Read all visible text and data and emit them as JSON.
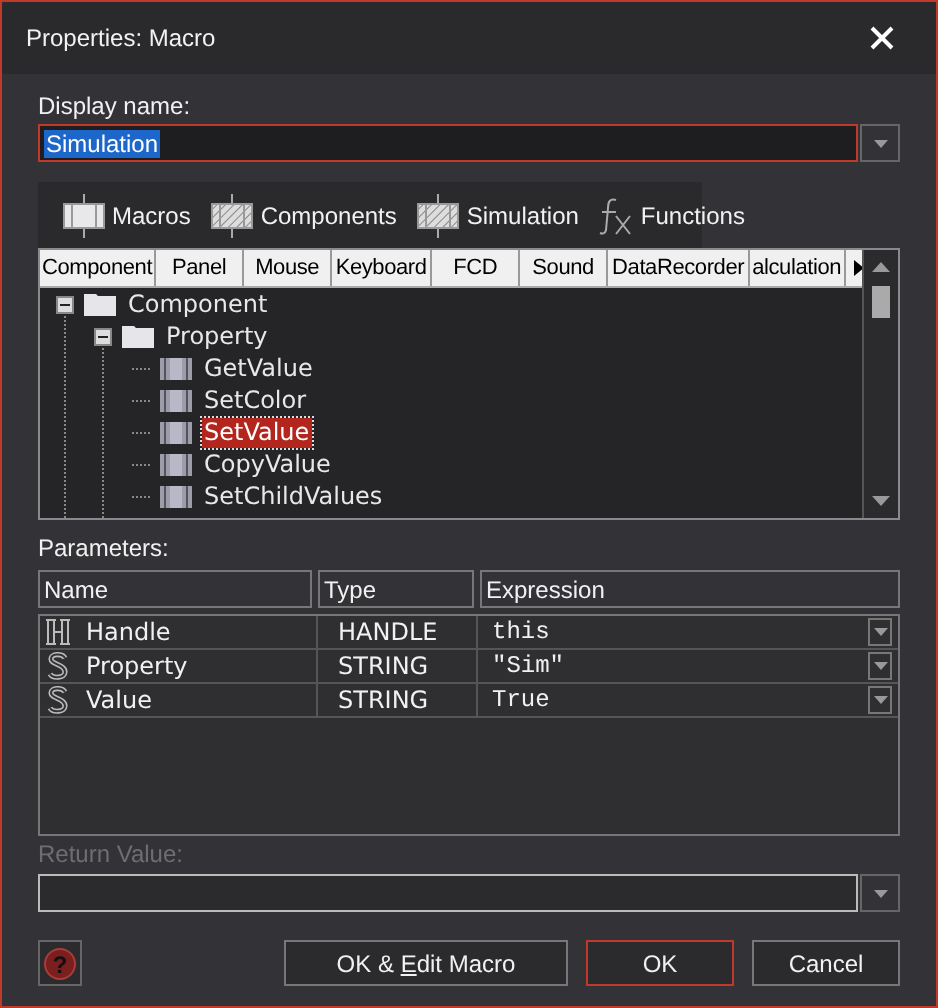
{
  "window": {
    "title": "Properties: Macro"
  },
  "display_name": {
    "label": "Display name:",
    "value": "Simulation",
    "value_selected": true,
    "focused": true
  },
  "tabs": [
    {
      "label": "Macros",
      "kind": "macros"
    },
    {
      "label": "Components",
      "kind": "components"
    },
    {
      "label": "Simulation",
      "kind": "simulation"
    },
    {
      "label": "Functions",
      "kind": "functions"
    }
  ],
  "tree": {
    "columns": [
      "Component",
      "Panel",
      "Mouse",
      "Keyboard",
      "FCD",
      "Sound",
      "DataRecorder",
      "alculation"
    ],
    "items": [
      {
        "label": "Component",
        "kind": "folder",
        "expanded": true,
        "selected": false,
        "children": [
          {
            "label": "Property",
            "kind": "folder",
            "expanded": true,
            "selected": false,
            "children": [
              {
                "label": "GetValue",
                "kind": "macro",
                "selected": false
              },
              {
                "label": "SetColor",
                "kind": "macro",
                "selected": false
              },
              {
                "label": "SetValue",
                "kind": "macro",
                "selected": true
              },
              {
                "label": "CopyValue",
                "kind": "macro",
                "selected": false
              },
              {
                "label": "SetChildValues",
                "kind": "macro",
                "selected": false
              }
            ]
          }
        ]
      }
    ]
  },
  "parameters": {
    "label": "Parameters:",
    "columns": [
      "Name",
      "Type",
      "Expression"
    ],
    "rows": [
      {
        "kind": "handle",
        "name": "Handle",
        "type": "HANDLE",
        "expression": "this"
      },
      {
        "kind": "string",
        "name": "Property",
        "type": "STRING",
        "expression": "\"Sim\""
      },
      {
        "kind": "string",
        "name": "Value",
        "type": "STRING",
        "expression": "True"
      }
    ]
  },
  "return_value": {
    "label": "Return Value:",
    "disabled": true
  },
  "buttons": [
    {
      "kind": "help",
      "glyph": "?",
      "default": false
    },
    {
      "kind": "text",
      "label": "OK & ",
      "mnemonic": "E",
      "label_end": "dit Macro",
      "default": false
    },
    {
      "kind": "text",
      "label": "OK",
      "default": true
    },
    {
      "kind": "text",
      "label": "Cancel",
      "default": false
    }
  ]
}
